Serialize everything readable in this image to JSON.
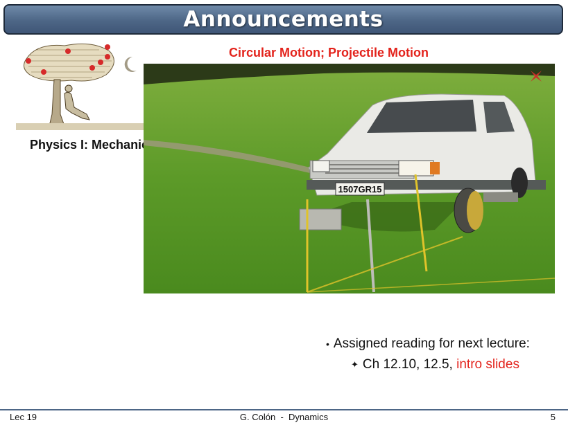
{
  "header": {
    "title": "Announcements"
  },
  "subtitle": "Circular Motion; Projectile Motion",
  "course_title": "Physics I: Mechanics",
  "photo": {
    "description_icon": "car-on-grass-photo",
    "plate": "1507GR15"
  },
  "bullets": {
    "reading_label": "Assigned reading for next lecture:",
    "reading_sections": "Ch 12.10, 12.5,",
    "reading_link": "intro slides"
  },
  "footer": {
    "left": "Lec 19",
    "center": "G. Colón  -  Dynamics",
    "right": "5"
  },
  "colors": {
    "accent": "#e3231c",
    "title_bar": "#4d6686"
  }
}
